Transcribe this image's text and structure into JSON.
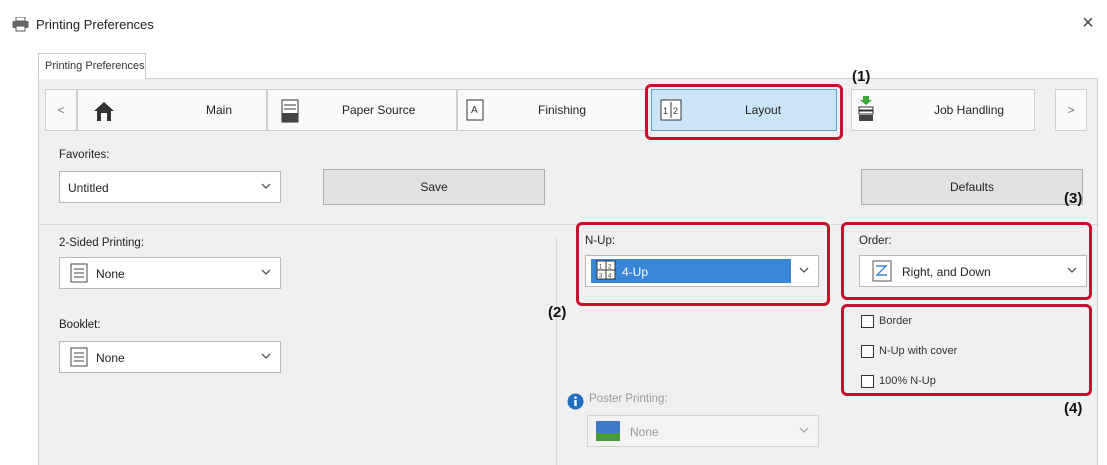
{
  "window": {
    "title": "Printing Preferences"
  },
  "tab": {
    "label": "Printing Preferences"
  },
  "nav": {
    "prev": "<",
    "next": ">",
    "items": [
      {
        "label": "Main",
        "icon": "home-icon"
      },
      {
        "label": "Paper Source",
        "icon": "paper-tray-icon"
      },
      {
        "label": "Finishing",
        "icon": "finishing-icon"
      },
      {
        "label": "Layout",
        "icon": "layout-icon"
      },
      {
        "label": "Job Handling",
        "icon": "job-handling-icon"
      }
    ]
  },
  "favorites": {
    "label": "Favorites:",
    "value": "Untitled"
  },
  "save_label": "Save",
  "defaults_label": "Defaults",
  "two_sided": {
    "label": "2-Sided Printing:",
    "value": "None"
  },
  "booklet": {
    "label": "Booklet:",
    "value": "None"
  },
  "nup": {
    "label": "N-Up:",
    "value": "4-Up"
  },
  "order": {
    "label": "Order:",
    "value": "Right, and Down"
  },
  "checkboxes": [
    {
      "label": "Border",
      "checked": false
    },
    {
      "label": "N-Up with cover",
      "checked": false
    },
    {
      "label": "100% N-Up",
      "checked": false
    }
  ],
  "poster": {
    "label": "Poster Printing:",
    "value": "None"
  },
  "callouts": [
    "(1)",
    "(2)",
    "(3)",
    "(4)"
  ],
  "colors": {
    "accent_red": "#c8102e",
    "selected_blue": "#3a86d6",
    "active_tab": "#cce4f7"
  }
}
